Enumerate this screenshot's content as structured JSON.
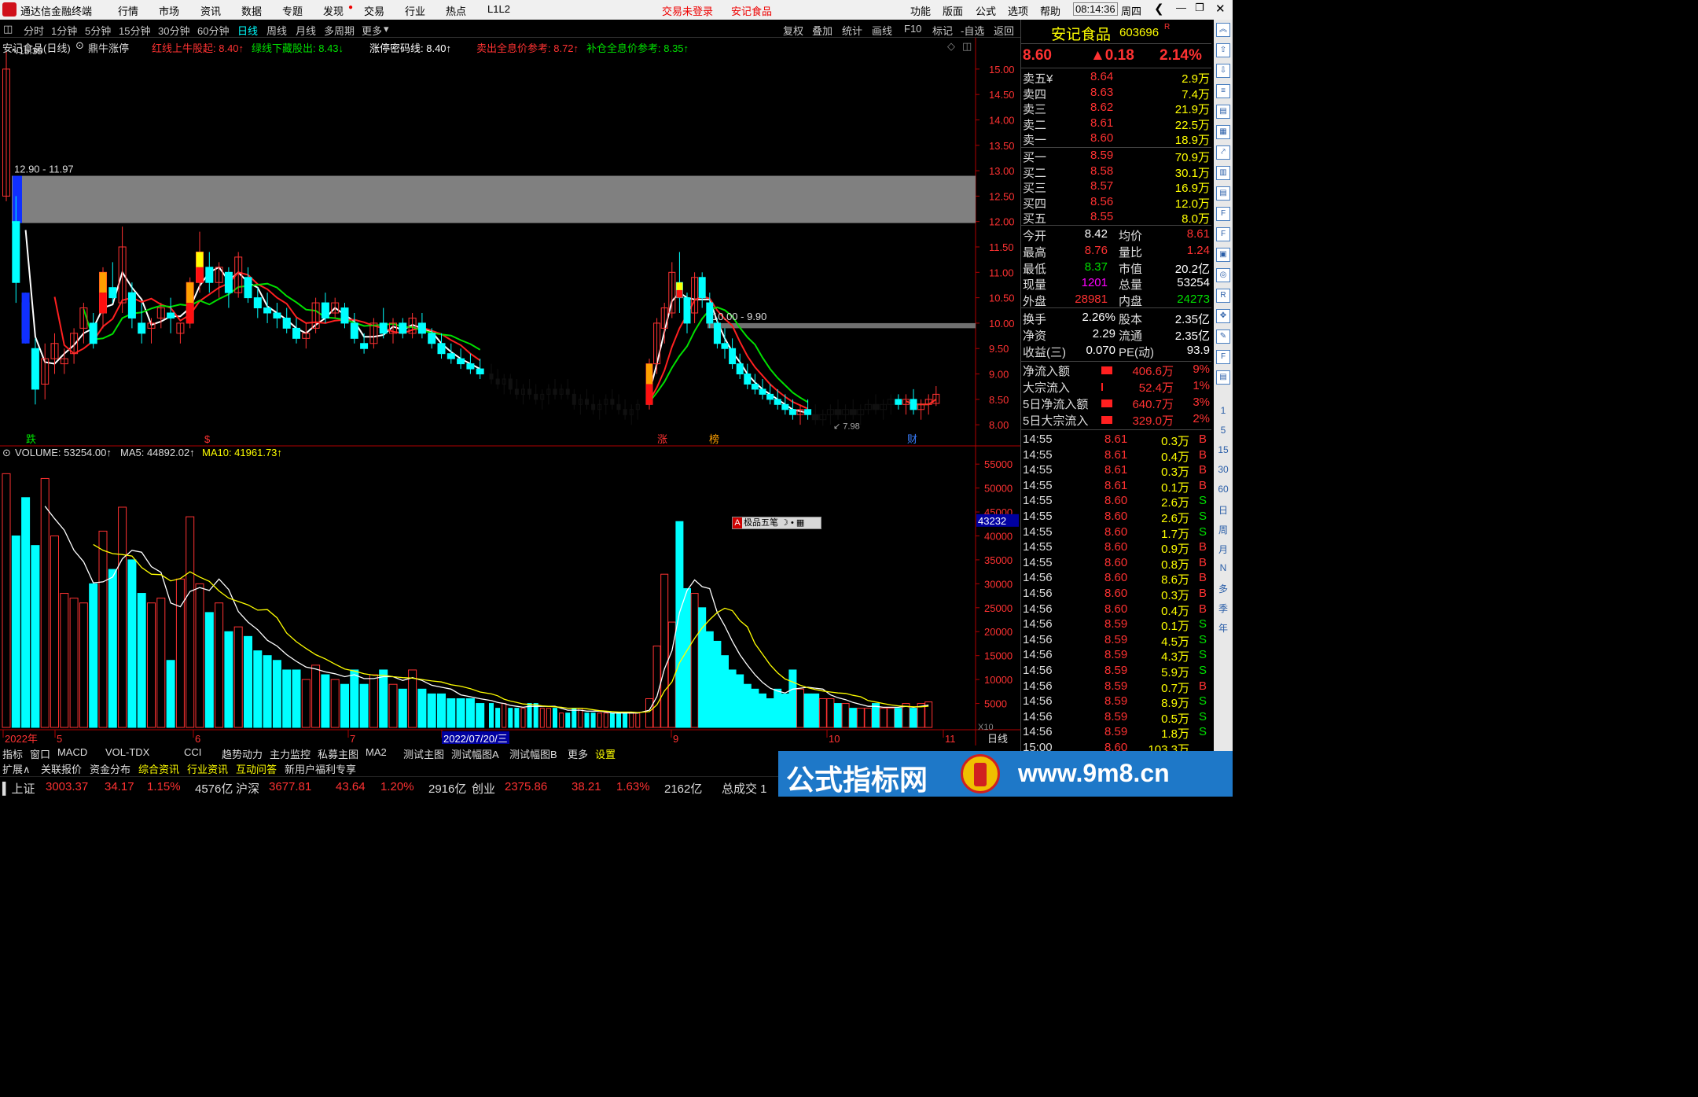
{
  "titlebar": {
    "app_name": "通达信金融终端",
    "menus": [
      "行情",
      "市场",
      "资讯",
      "数据",
      "专题",
      "发现",
      "交易",
      "行业",
      "热点",
      "L1L2"
    ],
    "login_status": "交易未登录",
    "stock_name": "安记食品",
    "right_menus": [
      "功能",
      "版面",
      "公式",
      "选项",
      "帮助"
    ],
    "time": "08:14:36",
    "weekday": "周四"
  },
  "periods": [
    "分时",
    "1分钟",
    "5分钟",
    "15分钟",
    "30分钟",
    "60分钟",
    "日线",
    "周线",
    "月线",
    "多周期",
    "更多"
  ],
  "active_period": "日线",
  "toolbar": [
    "复权",
    "叠加",
    "统计",
    "画线",
    "F10",
    "标记",
    "-自选",
    "返回"
  ],
  "chart_header": {
    "stock": "安记食品(日线)",
    "indicator": "鼎牛涨停",
    "items": [
      {
        "label": "红线上牛股起: 8.40↑",
        "color": "#ff3232"
      },
      {
        "label": "绿线下藏股出: 8.43↓",
        "color": "#00e000"
      },
      {
        "label": "涨停密码线: 8.40↑",
        "color": "#ffffff"
      },
      {
        "label": "卖出全息价参考: 8.72↑",
        "color": "#ff3232"
      },
      {
        "label": "补仓全息价参考: 8.35↑",
        "color": "#00e000"
      }
    ]
  },
  "price_labels": {
    "high": "15.35",
    "zone": "12.90 - 11.97",
    "zone2": "10.00 - 9.90",
    "low": "7.98"
  },
  "signals": {
    "die": "跌",
    "zhang": "涨",
    "bang": "榜",
    "cai": "财",
    "s": "$"
  },
  "volume_header": {
    "vol": "VOLUME: 53254.00↑",
    "ma5": "MA5: 44892.02↑",
    "ma10": "MA10: 41961.73↑"
  },
  "vol_cursor": "43232",
  "vol_unit": "X10",
  "popup": "极品五笔",
  "x_axis": [
    "2022年",
    "5",
    "6",
    "7",
    "2022/07/20/三",
    "9",
    "10",
    "11"
  ],
  "x_axis_label": "日线",
  "indicators": [
    "指标",
    "窗口",
    "MACD",
    "VOL-TDX",
    "CCI",
    "趋势动力",
    "主力监控",
    "私募主图",
    "MA2",
    "测试主图",
    "测试幅图A",
    "测试幅图B",
    "更多",
    "设置"
  ],
  "bottom_tabs": [
    "扩展∧",
    "关联报价",
    "资金分布",
    "综合资讯",
    "行业资讯",
    "互动问答",
    "新用户福利专享"
  ],
  "index_bar": [
    {
      "name": "上证",
      "value": "3003.37",
      "chg": "34.17",
      "pct": "1.15%",
      "amt": "4576亿"
    },
    {
      "name": "沪深",
      "value": "3677.81",
      "chg": "43.64",
      "pct": "1.20%",
      "amt": "2916亿"
    },
    {
      "name": "创业",
      "value": "2375.86",
      "chg": "38.21",
      "pct": "1.63%",
      "amt": "2162亿"
    }
  ],
  "index_tail": "总成交 1",
  "quote": {
    "name": "安记食品",
    "code": "603696",
    "badge": "R",
    "price": "8.60",
    "change": "▲0.18",
    "pct": "2.14%",
    "asks": [
      {
        "label": "卖五",
        "flag": "¥",
        "price": "8.64",
        "vol": "2.9万"
      },
      {
        "label": "卖四",
        "flag": "",
        "price": "8.63",
        "vol": "7.4万"
      },
      {
        "label": "卖三",
        "flag": "",
        "price": "8.62",
        "vol": "21.9万"
      },
      {
        "label": "卖二",
        "flag": "",
        "price": "8.61",
        "vol": "22.5万"
      },
      {
        "label": "卖一",
        "flag": "",
        "price": "8.60",
        "vol": "18.9万"
      }
    ],
    "bids": [
      {
        "label": "买一",
        "price": "8.59",
        "vol": "70.9万"
      },
      {
        "label": "买二",
        "price": "8.58",
        "vol": "30.1万"
      },
      {
        "label": "买三",
        "price": "8.57",
        "vol": "16.9万"
      },
      {
        "label": "买四",
        "price": "8.56",
        "vol": "12.0万"
      },
      {
        "label": "买五",
        "price": "8.55",
        "vol": "8.0万"
      }
    ],
    "stats": [
      {
        "l1": "今开",
        "v1": "8.42",
        "c1": "#ffffff",
        "l2": "均价",
        "v2": "8.61",
        "c2": "#ff3232"
      },
      {
        "l1": "最高",
        "v1": "8.76",
        "c1": "#ff3232",
        "l2": "量比",
        "v2": "1.24",
        "c2": "#ff3232"
      },
      {
        "l1": "最低",
        "v1": "8.37",
        "c1": "#00e000",
        "l2": "市值",
        "v2": "20.2亿",
        "c2": "#ffffff"
      },
      {
        "l1": "现量",
        "v1": "1201",
        "c1": "#ff00ff",
        "l2": "总量",
        "v2": "53254",
        "c2": "#ffffff"
      },
      {
        "l1": "外盘",
        "v1": "28981",
        "c1": "#ff3232",
        "l2": "内盘",
        "v2": "24273",
        "c2": "#00e000"
      }
    ],
    "stats2": [
      {
        "l1": "换手",
        "v1": "2.26%",
        "l2": "股本",
        "v2": "2.35亿"
      },
      {
        "l1": "净资",
        "v1": "2.29",
        "l2": "流通",
        "v2": "2.35亿"
      },
      {
        "l1": "收益(三)",
        "v1": "0.070",
        "l2": "PE(动)",
        "v2": "93.9"
      }
    ],
    "flows": [
      {
        "label": "净流入额",
        "value": "406.6万",
        "pct": "9%",
        "bar": 0.9
      },
      {
        "label": "大宗流入",
        "value": "52.4万",
        "pct": "1%",
        "bar": 0.1
      },
      {
        "label": "5日净流入额",
        "value": "640.7万",
        "pct": "3%",
        "bar": 0.85
      },
      {
        "label": "5日大宗流入",
        "value": "329.0万",
        "pct": "2%",
        "bar": 0.85
      }
    ],
    "ticks": [
      {
        "t": "14:55",
        "p": "8.61",
        "v": "0.3万",
        "s": "B"
      },
      {
        "t": "14:55",
        "p": "8.61",
        "v": "0.4万",
        "s": "B"
      },
      {
        "t": "14:55",
        "p": "8.61",
        "v": "0.3万",
        "s": "B"
      },
      {
        "t": "14:55",
        "p": "8.61",
        "v": "0.1万",
        "s": "B"
      },
      {
        "t": "14:55",
        "p": "8.60",
        "v": "2.6万",
        "s": "S"
      },
      {
        "t": "14:55",
        "p": "8.60",
        "v": "2.6万",
        "s": "S"
      },
      {
        "t": "14:55",
        "p": "8.60",
        "v": "1.7万",
        "s": "S"
      },
      {
        "t": "14:55",
        "p": "8.60",
        "v": "0.9万",
        "s": "B"
      },
      {
        "t": "14:55",
        "p": "8.60",
        "v": "0.8万",
        "s": "B"
      },
      {
        "t": "14:56",
        "p": "8.60",
        "v": "8.6万",
        "s": "B"
      },
      {
        "t": "14:56",
        "p": "8.60",
        "v": "0.3万",
        "s": "B"
      },
      {
        "t": "14:56",
        "p": "8.60",
        "v": "0.4万",
        "s": "B"
      },
      {
        "t": "14:56",
        "p": "8.59",
        "v": "0.1万",
        "s": "S"
      },
      {
        "t": "14:56",
        "p": "8.59",
        "v": "4.5万",
        "s": "S"
      },
      {
        "t": "14:56",
        "p": "8.59",
        "v": "4.3万",
        "s": "S"
      },
      {
        "t": "14:56",
        "p": "8.59",
        "v": "5.9万",
        "s": "S"
      },
      {
        "t": "14:56",
        "p": "8.59",
        "v": "0.7万",
        "s": "B"
      },
      {
        "t": "14:56",
        "p": "8.59",
        "v": "8.9万",
        "s": "S"
      },
      {
        "t": "14:56",
        "p": "8.59",
        "v": "0.5万",
        "s": "S"
      },
      {
        "t": "14:56",
        "p": "8.59",
        "v": "1.8万",
        "s": "S"
      },
      {
        "t": "15:00",
        "p": "8.60",
        "v": "103.3万",
        "s": ""
      }
    ]
  },
  "side_labels": [
    "1",
    "5",
    "15",
    "30",
    "60",
    "日",
    "周",
    "月",
    "N",
    "多",
    "季",
    "年"
  ],
  "watermark": {
    "text": "公式指标网",
    "url": "www.9m8.cn"
  },
  "chart_data": {
    "type": "candlestick",
    "ylim_price": [
      8.0,
      15.0
    ],
    "price_ticks": [
      "15.00",
      "14.50",
      "14.00",
      "13.50",
      "13.00",
      "12.50",
      "12.00",
      "11.50",
      "11.00",
      "10.50",
      "10.00",
      "9.50",
      "9.00",
      "8.50",
      "8.00"
    ],
    "ylim_volume": [
      0,
      55000
    ],
    "volume_ticks": [
      "55000",
      "50000",
      "45000",
      "40000",
      "35000",
      "30000",
      "25000",
      "20000",
      "15000",
      "10000",
      "5000"
    ],
    "candles": [
      [
        12.5,
        15.35,
        12.4,
        15.0
      ],
      [
        12.0,
        12.5,
        10.4,
        10.8
      ],
      [
        10.4,
        10.6,
        9.6,
        9.7
      ],
      [
        9.5,
        9.7,
        8.4,
        8.7
      ],
      [
        8.8,
        9.6,
        8.5,
        9.3
      ],
      [
        9.3,
        9.8,
        9.0,
        9.6
      ],
      [
        9.2,
        9.5,
        9.0,
        9.3
      ],
      [
        9.4,
        9.9,
        9.2,
        9.8
      ],
      [
        9.9,
        10.4,
        9.6,
        10.3
      ],
      [
        10.0,
        10.2,
        9.5,
        9.6
      ],
      [
        10.2,
        11.1,
        9.9,
        11.0
      ],
      [
        10.7,
        11.2,
        10.4,
        10.5
      ],
      [
        10.4,
        11.9,
        10.2,
        11.5
      ],
      [
        10.6,
        10.8,
        9.9,
        10.1
      ],
      [
        10.0,
        10.4,
        9.6,
        9.8
      ],
      [
        9.9,
        10.1,
        9.6,
        10.0
      ],
      [
        10.1,
        10.4,
        9.9,
        10.3
      ],
      [
        10.2,
        10.5,
        9.8,
        10.1
      ],
      [
        9.8,
        10.0,
        9.6,
        10.0
      ],
      [
        10.0,
        10.9,
        9.9,
        10.8
      ],
      [
        10.8,
        11.8,
        10.6,
        11.4
      ],
      [
        11.1,
        11.4,
        10.6,
        10.8
      ],
      [
        10.8,
        11.2,
        10.5,
        11.1
      ],
      [
        11.0,
        11.1,
        10.3,
        10.6
      ],
      [
        10.6,
        11.4,
        10.5,
        11.3
      ],
      [
        10.9,
        11.1,
        10.4,
        10.5
      ],
      [
        10.5,
        10.7,
        10.1,
        10.3
      ],
      [
        10.3,
        10.6,
        10.0,
        10.2
      ],
      [
        10.2,
        10.4,
        9.9,
        10.1
      ],
      [
        10.1,
        10.3,
        9.8,
        9.9
      ],
      [
        9.9,
        10.1,
        9.6,
        9.7
      ],
      [
        9.7,
        10.0,
        9.5,
        9.8
      ],
      [
        9.9,
        10.5,
        9.8,
        10.4
      ],
      [
        10.4,
        10.6,
        10.0,
        10.1
      ],
      [
        10.2,
        10.5,
        10.1,
        10.4
      ],
      [
        10.3,
        10.4,
        9.9,
        10.0
      ],
      [
        10.0,
        10.2,
        9.6,
        9.7
      ],
      [
        9.6,
        9.8,
        9.4,
        9.5
      ],
      [
        9.6,
        10.1,
        9.5,
        10.0
      ],
      [
        10.0,
        10.3,
        9.7,
        9.8
      ],
      [
        9.8,
        10.1,
        9.6,
        10.0
      ],
      [
        10.0,
        10.1,
        9.7,
        9.8
      ],
      [
        9.8,
        10.2,
        9.7,
        10.1
      ],
      [
        10.0,
        10.2,
        9.7,
        9.8
      ],
      [
        9.8,
        9.9,
        9.5,
        9.6
      ],
      [
        9.6,
        9.8,
        9.3,
        9.4
      ],
      [
        9.4,
        9.6,
        9.2,
        9.3
      ],
      [
        9.3,
        9.5,
        9.1,
        9.2
      ],
      [
        9.2,
        9.4,
        9.0,
        9.1
      ],
      [
        9.1,
        9.3,
        8.9,
        9.0
      ],
      [
        9.0,
        9.2,
        8.8,
        8.9
      ],
      [
        8.9,
        9.1,
        8.7,
        8.8
      ],
      [
        8.8,
        9.0,
        8.6,
        8.9
      ],
      [
        8.9,
        9.0,
        8.6,
        8.7
      ],
      [
        8.7,
        8.9,
        8.5,
        8.6
      ],
      [
        8.6,
        8.8,
        8.4,
        8.7
      ],
      [
        8.7,
        8.9,
        8.5,
        8.6
      ],
      [
        8.6,
        8.8,
        8.4,
        8.5
      ],
      [
        8.5,
        8.7,
        8.3,
        8.6
      ],
      [
        8.6,
        8.8,
        8.4,
        8.7
      ],
      [
        8.7,
        8.9,
        8.5,
        8.6
      ],
      [
        8.6,
        8.8,
        8.5,
        8.7
      ],
      [
        8.7,
        8.9,
        8.5,
        8.6
      ],
      [
        8.6,
        8.7,
        8.3,
        8.4
      ],
      [
        8.4,
        8.6,
        8.2,
        8.5
      ],
      [
        8.5,
        8.7,
        8.3,
        8.4
      ],
      [
        8.4,
        8.6,
        8.2,
        8.3
      ],
      [
        8.3,
        8.5,
        8.1,
        8.4
      ],
      [
        8.4,
        8.6,
        8.2,
        8.5
      ],
      [
        8.5,
        8.7,
        8.3,
        8.4
      ],
      [
        8.4,
        8.6,
        8.2,
        8.3
      ],
      [
        8.3,
        8.5,
        8.1,
        8.2
      ],
      [
        8.2,
        8.4,
        8.0,
        8.3
      ],
      [
        8.3,
        8.5,
        8.1,
        8.4
      ],
      [
        8.4,
        9.3,
        8.3,
        9.2
      ],
      [
        9.2,
        10.1,
        9.0,
        10.0
      ],
      [
        9.9,
        10.4,
        9.6,
        10.3
      ],
      [
        10.2,
        11.2,
        10.1,
        11.0
      ],
      [
        10.8,
        11.4,
        10.2,
        10.5
      ],
      [
        10.5,
        10.6,
        9.8,
        10.0
      ],
      [
        10.2,
        11.0,
        10.0,
        10.9
      ],
      [
        10.9,
        11.0,
        10.3,
        10.5
      ],
      [
        10.4,
        10.6,
        9.9,
        10.0
      ],
      [
        10.0,
        10.1,
        9.5,
        9.6
      ],
      [
        9.6,
        9.9,
        9.3,
        9.5
      ],
      [
        9.5,
        9.7,
        9.1,
        9.2
      ],
      [
        9.2,
        9.4,
        8.9,
        9.0
      ],
      [
        9.0,
        9.2,
        8.7,
        8.8
      ],
      [
        8.8,
        9.0,
        8.6,
        8.7
      ],
      [
        8.7,
        8.9,
        8.5,
        8.6
      ],
      [
        8.6,
        8.8,
        8.4,
        8.5
      ],
      [
        8.5,
        8.7,
        8.3,
        8.4
      ],
      [
        8.4,
        8.6,
        8.2,
        8.3
      ],
      [
        8.3,
        8.5,
        8.1,
        8.2
      ],
      [
        8.2,
        8.4,
        8.0,
        8.3
      ],
      [
        8.3,
        8.5,
        8.1,
        8.2
      ],
      [
        8.2,
        8.4,
        8.0,
        8.1
      ],
      [
        8.1,
        8.3,
        7.98,
        8.2
      ],
      [
        8.2,
        8.4,
        8.0,
        8.3
      ],
      [
        8.3,
        8.5,
        8.1,
        8.2
      ],
      [
        8.2,
        8.4,
        8.1,
        8.3
      ],
      [
        8.3,
        8.5,
        8.1,
        8.2
      ],
      [
        8.2,
        8.4,
        8.0,
        8.3
      ],
      [
        8.3,
        8.5,
        8.2,
        8.4
      ],
      [
        8.4,
        8.6,
        8.2,
        8.3
      ],
      [
        8.3,
        8.5,
        8.1,
        8.4
      ],
      [
        8.4,
        8.6,
        8.2,
        8.5
      ],
      [
        8.5,
        8.6,
        8.3,
        8.4
      ],
      [
        8.4,
        8.6,
        8.2,
        8.5
      ],
      [
        8.5,
        8.7,
        8.2,
        8.3
      ],
      [
        8.3,
        8.5,
        8.1,
        8.4
      ],
      [
        8.4,
        8.6,
        8.2,
        8.5
      ],
      [
        8.42,
        8.76,
        8.37,
        8.6
      ]
    ],
    "volumes": [
      53000,
      40000,
      48000,
      38000,
      52000,
      40000,
      28000,
      27000,
      26000,
      30000,
      41000,
      33000,
      46000,
      35000,
      28000,
      26000,
      27000,
      14000,
      31000,
      44000,
      30000,
      24000,
      26000,
      20000,
      21000,
      19000,
      16000,
      15000,
      14000,
      12000,
      12000,
      10000,
      13000,
      11000,
      10000,
      9000,
      12000,
      9000,
      11000,
      12000,
      9000,
      8000,
      12000,
      8000,
      7000,
      7000,
      6000,
      6000,
      6000,
      5000,
      5000,
      4000,
      5000,
      4000,
      4000,
      4000,
      5000,
      5000,
      4000,
      4000,
      4000,
      3000,
      3000,
      4000,
      4000,
      3000,
      3000,
      3000,
      3000,
      3000,
      3000,
      3000,
      3000,
      3000,
      6000,
      17000,
      32000,
      22000,
      43000,
      29000,
      28000,
      25000,
      20000,
      18000,
      15000,
      12000,
      11000,
      9000,
      8000,
      7000,
      6000,
      8000,
      7000,
      12000,
      8000,
      7000,
      7000,
      6000,
      6000,
      5000,
      5000,
      4000,
      4000,
      4000,
      5000,
      4000,
      4000,
      4000,
      5000,
      4000,
      5000,
      5325
    ]
  }
}
